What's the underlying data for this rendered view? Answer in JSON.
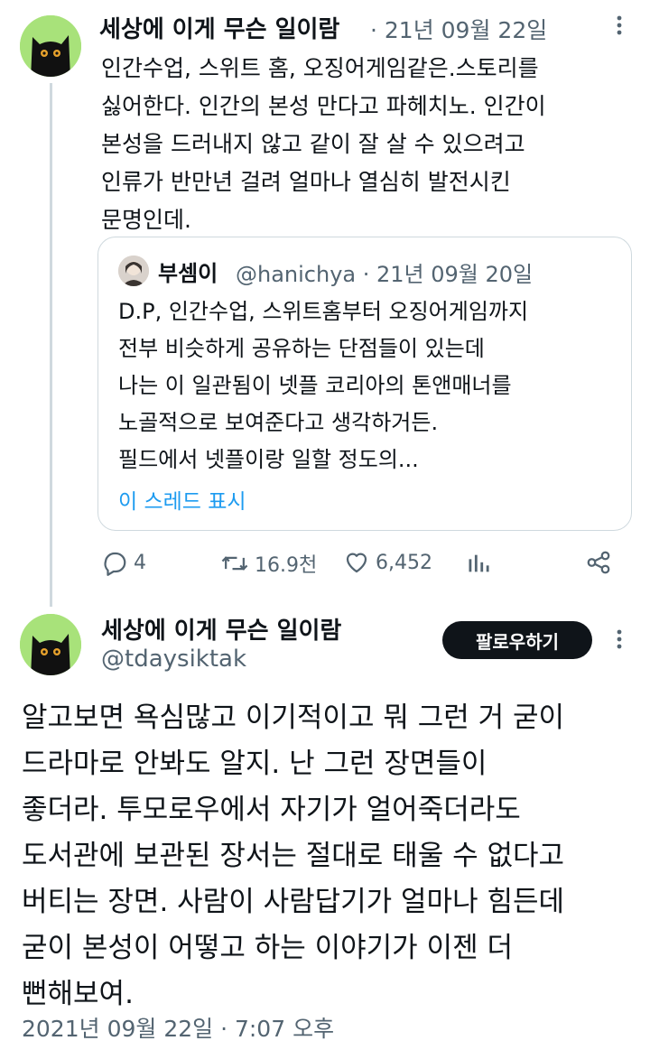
{
  "tweet1": {
    "display_name": "세상에 이게 무슨 일이람",
    "date": "· 21년 09월 22일",
    "text": "인간수업, 스위트 홈, 오징어게임같은.스토리를\n싫어한다. 인간의 본성 만다고 파헤치노. 인간이\n본성을 드러내지 않고 같이 잘 살 수 있으려고\n인류가 반만년 걸려 얼마나 열심히 발전시킨\n문명인데.",
    "quote": {
      "display_name": "부셈이",
      "handle_date": "@hanichya · 21년 09월 20일",
      "text": "D.P, 인간수업, 스위트홈부터 오징어게임까지\n전부 비슷하게 공유하는 단점들이 있는데\n나는 이 일관됨이 넷플 코리아의 톤앤매너를\n노골적으로 보여준다고 생각하거든.\n필드에서 넷플이랑 일할 정도의...",
      "show_thread": "이 스레드 표시"
    },
    "actions": {
      "replies": "4",
      "retweets": "16.9천",
      "likes": "6,452"
    }
  },
  "tweet2": {
    "display_name": "세상에 이게 무슨 일이람",
    "handle": "@tdaysiktak",
    "follow_label": "팔로우하기",
    "text": "알고보면 욕심많고 이기적이고 뭐 그런 거 굳이\n드라마로 안봐도 알지. 난 그런 장면들이\n좋더라. 투모로우에서 자기가 얼어죽더라도\n도서관에 보관된 장서는 절대로 태울 수 없다고\n버티는 장면. 사람이 사람답기가 얼마나 힘든데\n굳이 본성이 어떻고 하는 이야기가 이젠 더\n뻔해보여.",
    "timestamp": "2021년 09월 22일 · 7:07 오후"
  },
  "colors": {
    "avatar_bg": "#a8e27a",
    "link": "#1d9bf0",
    "muted": "#536471"
  }
}
